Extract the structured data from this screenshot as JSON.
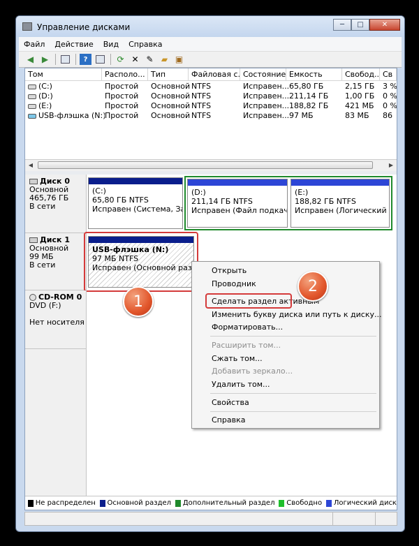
{
  "window": {
    "title": "Управление дисками",
    "min_label": "─",
    "max_label": "□",
    "close_label": "✕"
  },
  "menu": [
    "Файл",
    "Действие",
    "Вид",
    "Справка"
  ],
  "toolbar_icons": [
    "back-arrow-icon",
    "forward-arrow-icon",
    "console-tree-icon",
    "help-icon",
    "properties-icon",
    "refresh-icon",
    "delete-icon",
    "new-volume-icon",
    "open-icon",
    "explore-icon"
  ],
  "volume_table": {
    "columns": [
      "Том",
      "Располо...",
      "Тип",
      "Файловая с...",
      "Состояние",
      "Емкость",
      "Свобод...",
      "Св"
    ],
    "rows": [
      [
        "(C:)",
        "Простой",
        "Основной",
        "NTFS",
        "Исправен...",
        "65,80 ГБ",
        "2,15 ГБ",
        "3 %"
      ],
      [
        "(D:)",
        "Простой",
        "Основной",
        "NTFS",
        "Исправен...",
        "211,14 ГБ",
        "1,00 ГБ",
        "0 %"
      ],
      [
        "(E:)",
        "Простой",
        "Основной",
        "NTFS",
        "Исправен...",
        "188,82 ГБ",
        "421 МБ",
        "0 %"
      ],
      [
        "USB-флэшка (N:)",
        "Простой",
        "Основной",
        "NTFS",
        "Исправен...",
        "97 МБ",
        "83 МБ",
        "86"
      ]
    ]
  },
  "disks": [
    {
      "name": "Диск 0",
      "type": "Основной",
      "size": "465,76 ГБ",
      "status": "В сети"
    },
    {
      "name": "Диск 1",
      "type": "Основной",
      "size": "99 МБ",
      "status": "В сети"
    },
    {
      "name": "CD-ROM 0",
      "type": "DVD (F:)",
      "size": "",
      "status": "Нет носителя"
    }
  ],
  "partitions": {
    "c": {
      "label": "(C:)",
      "size": "65,80 ГБ NTFS",
      "status": "Исправен (Система, Загру"
    },
    "d": {
      "label": "(D:)",
      "size": "211,14 ГБ NTFS",
      "status": "Исправен (Файл подкачки, Л"
    },
    "e": {
      "label": "(E:)",
      "size": "188,82 ГБ NTFS",
      "status": "Исправен (Логический диск"
    },
    "n": {
      "label": "USB-флэшка  (N:)",
      "size": "97 МБ NTFS",
      "status": "Исправен (Основной раздел)"
    }
  },
  "context_menu": {
    "items": [
      {
        "label": "Открыть",
        "enabled": true
      },
      {
        "label": "Проводник",
        "enabled": true
      },
      {
        "label": "Сделать раздел активным",
        "enabled": true
      },
      {
        "label": "Изменить букву диска или путь к диску...",
        "enabled": true
      },
      {
        "label": "Форматировать...",
        "enabled": true
      },
      {
        "label": "Расширить том...",
        "enabled": false
      },
      {
        "label": "Сжать том...",
        "enabled": true
      },
      {
        "label": "Добавить зеркало...",
        "enabled": false
      },
      {
        "label": "Удалить том...",
        "enabled": true
      },
      {
        "label": "Свойства",
        "enabled": true
      },
      {
        "label": "Справка",
        "enabled": true
      }
    ]
  },
  "callouts": {
    "one": "1",
    "two": "2"
  },
  "legend": [
    {
      "label": "Не распределен",
      "color": "#000000"
    },
    {
      "label": "Основной раздел",
      "color": "#0a1e8c"
    },
    {
      "label": "Дополнительный раздел",
      "color": "#1f8a2c"
    },
    {
      "label": "Свободно",
      "color": "#1fbf2c"
    },
    {
      "label": "Логический диск",
      "color": "#2d46d6"
    }
  ],
  "colors": {
    "primary_partition": "#0a1e8c",
    "logical_disk": "#2d46d6",
    "extended_border": "#1f8a2c",
    "highlight_red": "#d43a3a",
    "callout": "#e2562b"
  }
}
